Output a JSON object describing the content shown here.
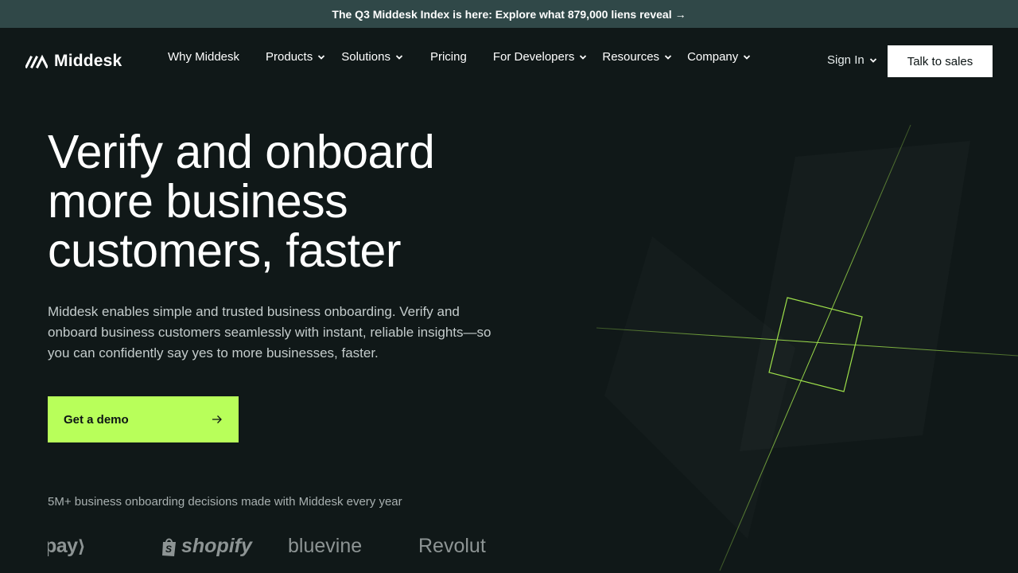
{
  "announcement": {
    "text": "The Q3 Middesk Index is here: Explore what 879,000 liens reveal",
    "arrow": "→"
  },
  "brand": {
    "name": "Middesk",
    "logo_icon": "middesk-logo-icon"
  },
  "nav": {
    "items": [
      {
        "label": "Why Middesk",
        "has_dropdown": false
      },
      {
        "label": "Products",
        "has_dropdown": true
      },
      {
        "label": "Solutions",
        "has_dropdown": true
      },
      {
        "label": "Pricing",
        "has_dropdown": false
      },
      {
        "label": "For Developers",
        "has_dropdown": true
      },
      {
        "label": "Resources",
        "has_dropdown": true
      },
      {
        "label": "Company",
        "has_dropdown": true
      }
    ],
    "sign_in": "Sign In",
    "cta": "Talk to sales"
  },
  "hero": {
    "title_lines": [
      "Verify and onboard",
      "more business",
      "customers, faster"
    ],
    "subtitle": "Middesk enables simple and trusted business onboarding. Verify and onboard business customers seamlessly with instant, reliable insights—so you can confidently say yes to more businesses, faster.",
    "cta": "Get a demo",
    "cta_icon": "arrow-right-icon"
  },
  "social_proof": {
    "stat": "5M+ business onboarding decisions made with Middesk every year",
    "logos": [
      "pay",
      "shopify",
      "bluevine",
      "Revolut"
    ]
  },
  "colors": {
    "background": "#101818",
    "announcement_bg": "#304848",
    "accent": "#b8ff5a",
    "line_accent": "#9ee04a"
  }
}
